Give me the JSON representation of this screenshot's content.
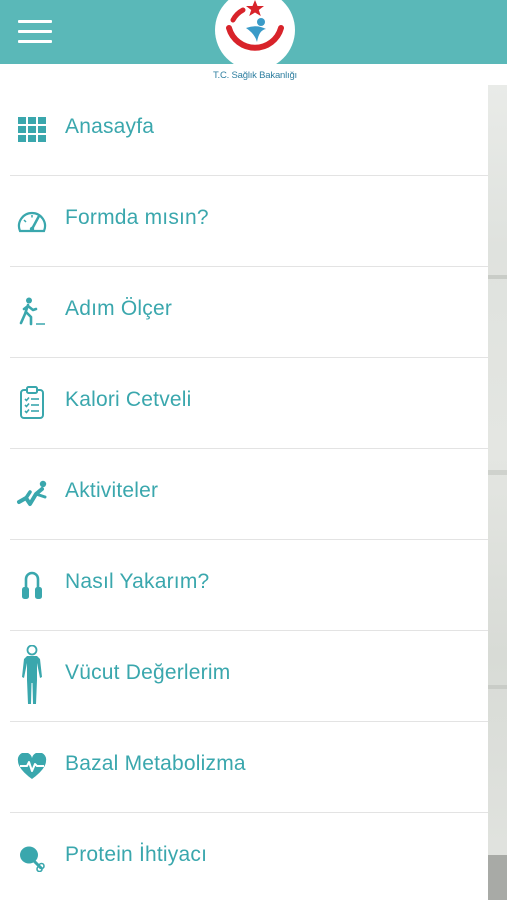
{
  "header": {
    "menu_button": "hamburger-menu",
    "logo_text": "T.C. Sağlık Bakanlığı"
  },
  "menu": {
    "items": [
      {
        "label": "Anasayfa",
        "icon": "grid-icon"
      },
      {
        "label": "Formda mısın?",
        "icon": "speedometer-icon"
      },
      {
        "label": "Adım Ölçer",
        "icon": "walking-icon"
      },
      {
        "label": "Kalori Cetveli",
        "icon": "clipboard-icon"
      },
      {
        "label": "Aktiviteler",
        "icon": "situp-icon"
      },
      {
        "label": "Nasıl Yakarım?",
        "icon": "hand-grip-icon"
      },
      {
        "label": "Vücut Değerlerim",
        "icon": "body-icon"
      },
      {
        "label": "Bazal Metabolizma",
        "icon": "heart-pulse-icon"
      },
      {
        "label": "Protein İhtiyacı",
        "icon": "drumstick-icon"
      }
    ]
  },
  "colors": {
    "header": "#5ab8b8",
    "accent": "#3aa7ad",
    "logo_red": "#d8232a"
  }
}
